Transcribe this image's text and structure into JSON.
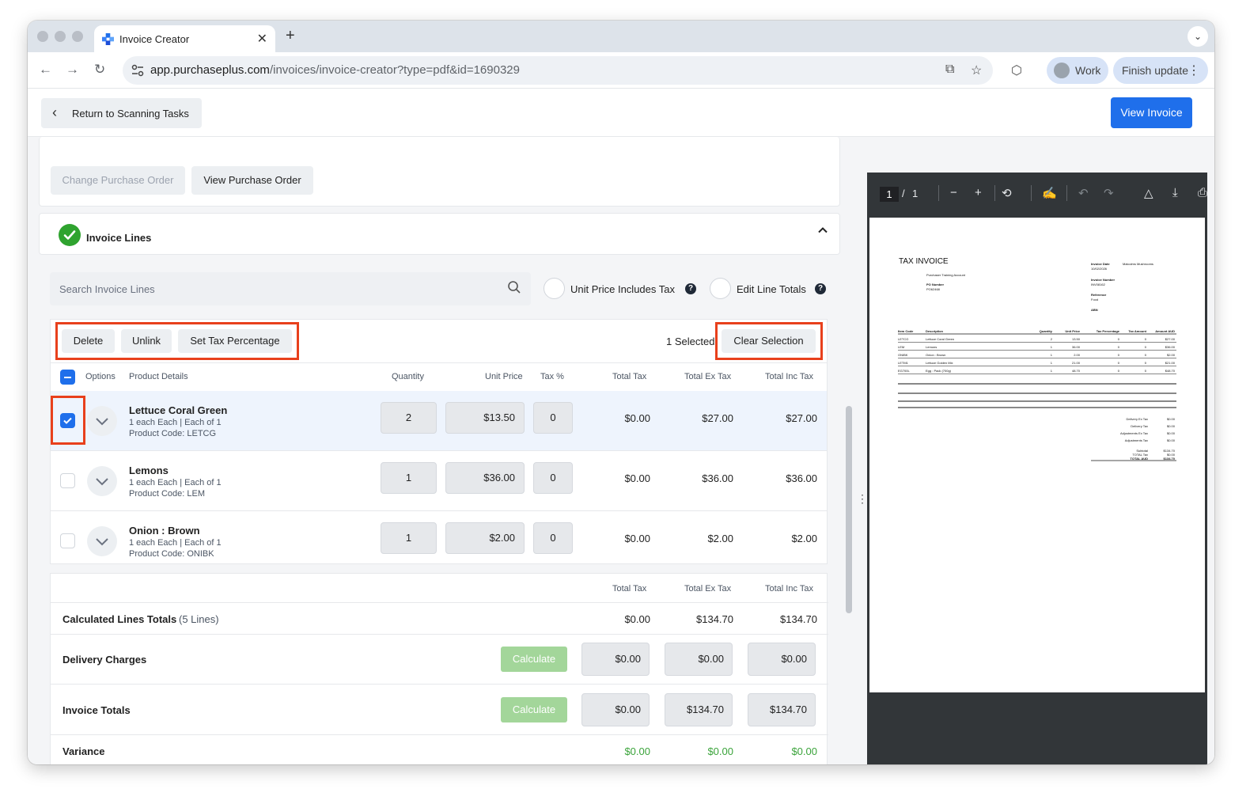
{
  "browser": {
    "tab_title": "Invoice Creator",
    "url_domain": "app.purchaseplus.com",
    "url_path": "/invoices/invoice-creator?type=pdf&id=1690329",
    "profile_label": "Work",
    "finish_update_label": "Finish update"
  },
  "header": {
    "return_label": "Return to Scanning Tasks",
    "view_invoice_label": "View Invoice"
  },
  "po": {
    "change_label": "Change Purchase Order",
    "view_label": "View Purchase Order"
  },
  "invoice_lines": {
    "title": "Invoice Lines",
    "search_placeholder": "Search Invoice Lines",
    "unit_price_tax_label": "Unit Price Includes Tax",
    "edit_line_totals_label": "Edit Line Totals",
    "help_glyph": "?",
    "actions": {
      "delete": "Delete",
      "unlink": "Unlink",
      "set_tax": "Set Tax Percentage",
      "selected": "1 Selected",
      "clear": "Clear Selection"
    },
    "columns": {
      "options": "Options",
      "product": "Product Details",
      "quantity": "Quantity",
      "unit_price": "Unit Price",
      "tax_pct": "Tax %",
      "total_tax": "Total Tax",
      "total_ex": "Total Ex Tax",
      "total_inc": "Total Inc Tax"
    },
    "rows": [
      {
        "name": "Lettuce Coral Green",
        "unit": "1 each Each | Each of 1",
        "code": "Product Code: LETCG",
        "qty": "2",
        "price": "$13.50",
        "tax": "0",
        "total_tax": "$0.00",
        "total_ex": "$27.00",
        "total_inc": "$27.00",
        "selected": true
      },
      {
        "name": "Lemons",
        "unit": "1 each Each | Each of 1",
        "code": "Product Code: LEM",
        "qty": "1",
        "price": "$36.00",
        "tax": "0",
        "total_tax": "$0.00",
        "total_ex": "$36.00",
        "total_inc": "$36.00",
        "selected": false
      },
      {
        "name": "Onion : Brown",
        "unit": "1 each Each | Each of 1",
        "code": "Product Code: ONIBK",
        "qty": "1",
        "price": "$2.00",
        "tax": "0",
        "total_tax": "$0.00",
        "total_ex": "$2.00",
        "total_inc": "$2.00",
        "selected": false
      }
    ]
  },
  "totals": {
    "headers": {
      "total_tax": "Total Tax",
      "total_ex": "Total Ex Tax",
      "total_inc": "Total Inc Tax"
    },
    "calculated": {
      "label": "Calculated Lines Totals",
      "count": "(5 Lines)",
      "tax": "$0.00",
      "ex": "$134.70",
      "inc": "$134.70"
    },
    "delivery": {
      "label": "Delivery Charges",
      "calc_label": "Calculate",
      "tax": "$0.00",
      "ex": "$0.00",
      "inc": "$0.00"
    },
    "invoice": {
      "label": "Invoice Totals",
      "calc_label": "Calculate",
      "tax": "$0.00",
      "ex": "$134.70",
      "inc": "$134.70"
    },
    "variance": {
      "label": "Variance",
      "tax": "$0.00",
      "ex": "$0.00",
      "inc": "$0.00"
    }
  },
  "pdf_viewer": {
    "page_current": "1",
    "page_sep": "/",
    "page_total": "1",
    "doc": {
      "title": "TAX INVOICE",
      "purchaser": "Purchaser Training Account",
      "po_label": "PO Number",
      "po_value": "PO62468",
      "inv_date_label": "Invoice Date",
      "inv_date_value": "10/02/2026",
      "supplier": "Malcolms Mushrooms",
      "inv_num_label": "Invoice Number",
      "inv_num_value": "INV08162",
      "ref_label": "Reference",
      "ref_value": "Food",
      "abn_label": "ABN",
      "cols": [
        "Item Code",
        "Description",
        "Quantity",
        "Unit Price",
        "Tax Percentage",
        "Tax Amount",
        "Amount AUD"
      ],
      "lines": [
        [
          "LETCG",
          "Lettuce Coral Green",
          "2",
          "13.50",
          "0",
          "0",
          "$27.00"
        ],
        [
          "LEM",
          "Lemons",
          "1",
          "36.00",
          "0",
          "0",
          "$36.00"
        ],
        [
          "ONIBK",
          "Onion : Brown",
          "1",
          "2.00",
          "0",
          "0",
          "$2.00"
        ],
        [
          "LETM1",
          "Lettuce Golden Mix",
          "1",
          "21.00",
          "0",
          "0",
          "$21.00"
        ],
        [
          "EG700L",
          "Egg : Pack (700g)",
          "1",
          "48.70",
          "0",
          "0",
          "$48.70"
        ]
      ],
      "summary": [
        [
          "Delivery Ex Tax",
          "$0.00"
        ],
        [
          "Delivery Tax",
          "$0.00"
        ],
        [
          "Adjustments Ex Tax",
          "$0.00"
        ],
        [
          "Adjustments Tax",
          "$0.00"
        ],
        [
          "Subtotal",
          "$134.70"
        ],
        [
          "TOTAL Tax",
          "$0.00"
        ],
        [
          "TOTAL AUD",
          "$134.70"
        ]
      ]
    }
  },
  "colors": {
    "accent": "#1f6feb",
    "success": "#2fa32f",
    "highlight": "#e8401c",
    "calc_button": "#a3d69a"
  }
}
